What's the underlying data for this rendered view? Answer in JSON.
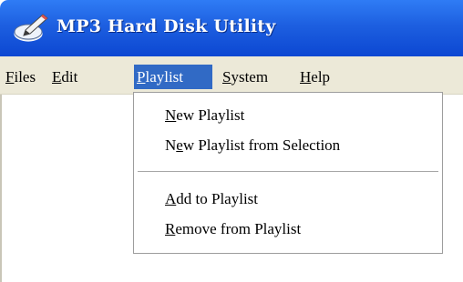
{
  "window": {
    "title": "MP3 Hard Disk Utility",
    "icon": "pencil-disk-icon"
  },
  "menubar": {
    "items": [
      {
        "label": "Files",
        "mnemonic": "F",
        "rest": "iles"
      },
      {
        "label": "Edit",
        "mnemonic": "E",
        "rest": "dit"
      },
      {
        "label": "Playlist",
        "mnemonic": "P",
        "rest": "laylist",
        "active": true
      },
      {
        "label": "System",
        "mnemonic": "S",
        "rest": "ystem"
      },
      {
        "label": "Help",
        "mnemonic": "H",
        "rest": "elp"
      }
    ]
  },
  "playlist_menu": {
    "items": [
      {
        "label": "New Playlist",
        "mnemonic": "N",
        "rest": "ew Playlist"
      },
      {
        "label": "New Playlist from Selection",
        "pre": "N",
        "mnemonic": "e",
        "rest": "w Playlist from Selection"
      },
      {
        "label": "Add to Playlist",
        "mnemonic": "A",
        "rest": "dd to Playlist"
      },
      {
        "label": "Remove from Playlist",
        "mnemonic": "R",
        "rest": "emove from Playlist"
      }
    ]
  },
  "colors": {
    "titlebar": "#1d5fe0",
    "menubar": "#ece9d8",
    "highlight": "#316ac5"
  }
}
